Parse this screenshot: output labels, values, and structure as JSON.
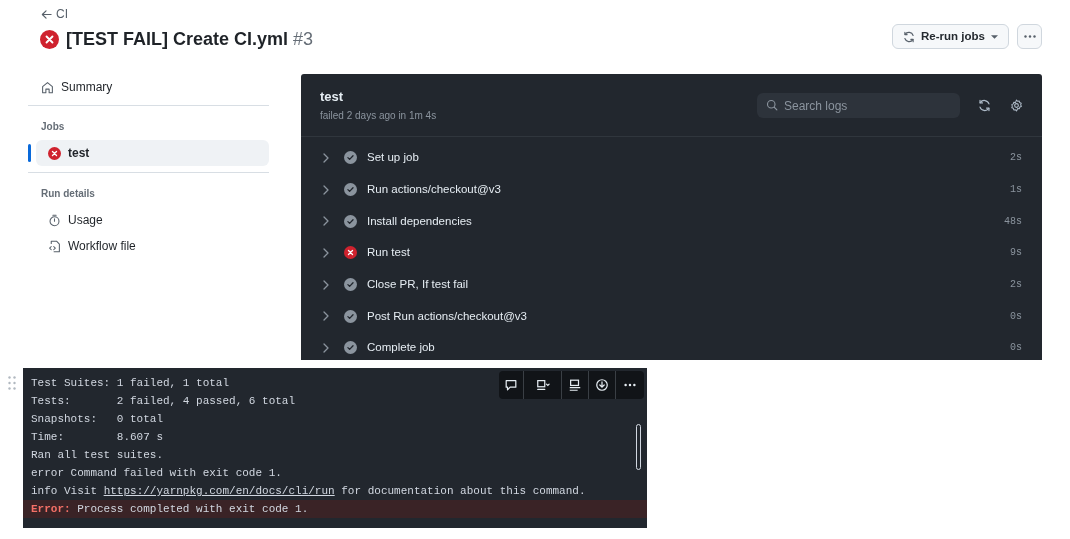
{
  "back_link": "CI",
  "title": {
    "kind": "failure",
    "text": "[TEST FAIL] Create CI.yml",
    "number": "#3"
  },
  "rerun_button": "Re-run jobs",
  "sidebar": {
    "summary": "Summary",
    "sections": [
      {
        "heading": "Jobs",
        "items": [
          {
            "label": "test",
            "kind": "failure",
            "selected": true
          }
        ]
      },
      {
        "heading": "Run details",
        "items": [
          {
            "label": "Usage",
            "kind": "stopwatch",
            "selected": false
          },
          {
            "label": "Workflow file",
            "kind": "file",
            "selected": false
          }
        ]
      }
    ]
  },
  "job": {
    "name": "test",
    "subtitle": "failed 2 days ago in 1m 4s",
    "search": {
      "placeholder": "Search logs"
    },
    "steps": [
      {
        "name": "Set up job",
        "kind": "success",
        "duration": "2s"
      },
      {
        "name": "Run actions/checkout@v3",
        "kind": "success",
        "duration": "1s"
      },
      {
        "name": "Install dependencies",
        "kind": "success",
        "duration": "48s"
      },
      {
        "name": "Run test",
        "kind": "failure",
        "duration": "9s"
      },
      {
        "name": "Close PR, If test fail",
        "kind": "success",
        "duration": "2s"
      },
      {
        "name": "Post Run actions/checkout@v3",
        "kind": "success",
        "duration": "0s"
      },
      {
        "name": "Complete job",
        "kind": "success",
        "duration": "0s"
      }
    ]
  },
  "terminal": {
    "lines": [
      {
        "kind": "plain",
        "text": "Test Suites: 1 failed, 1 total"
      },
      {
        "kind": "plain",
        "text": "Tests:       2 failed, 4 passed, 6 total"
      },
      {
        "kind": "plain",
        "text": "Snapshots:   0 total"
      },
      {
        "kind": "plain",
        "text": "Time:        8.607 s"
      },
      {
        "kind": "plain",
        "text": "Ran all test suites."
      },
      {
        "kind": "plain",
        "text": "error Command failed with exit code 1."
      },
      {
        "kind": "link",
        "before": "info Visit ",
        "link": "https://yarnpkg.com/en/docs/cli/run",
        "after": " for documentation about this command."
      },
      {
        "kind": "error",
        "label": "Error:",
        "text": " Process completed with exit code 1."
      }
    ]
  }
}
